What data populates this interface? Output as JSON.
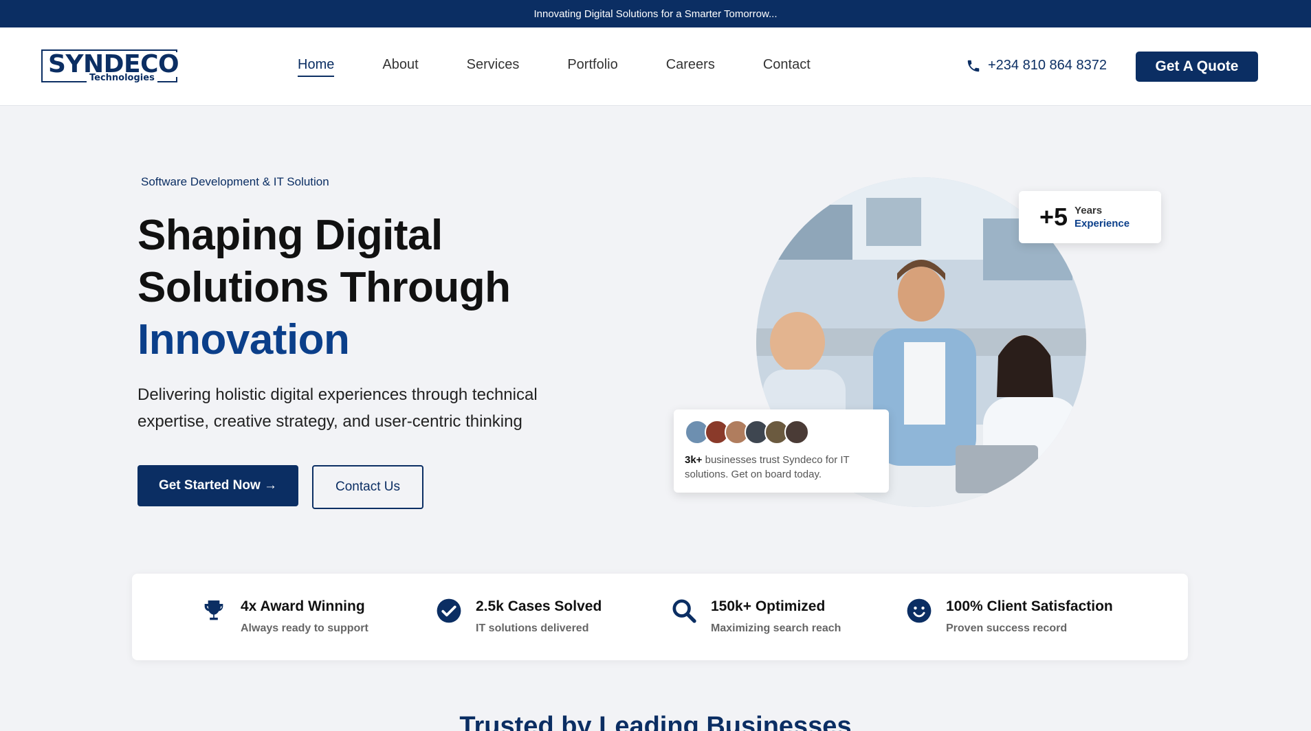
{
  "topbar": {
    "text": "Innovating Digital Solutions for a Smarter Tomorrow..."
  },
  "logo": {
    "main": "SYNDECO",
    "sub": "Technologies"
  },
  "nav": {
    "items": [
      {
        "label": "Home",
        "active": true
      },
      {
        "label": "About"
      },
      {
        "label": "Services"
      },
      {
        "label": "Portfolio"
      },
      {
        "label": "Careers"
      },
      {
        "label": "Contact"
      }
    ]
  },
  "header": {
    "phone": "+234 810 864 8372",
    "quote_label": "Get A Quote"
  },
  "hero": {
    "eyebrow": "Software Development & IT Solution",
    "title_line1": "Shaping Digital",
    "title_line2": "Solutions Through",
    "title_accent": "Innovation",
    "description": "Delivering holistic digital experiences through technical expertise, creative strategy, and user-centric thinking",
    "primary_label": "Get Started Now →",
    "secondary_label": "Contact Us"
  },
  "experience": {
    "number": "+5",
    "line1": "Years",
    "line2": "Experience"
  },
  "trust": {
    "count": "3k+",
    "text": " businesses trust Syndeco for IT solutions. Get on board today."
  },
  "stats": [
    {
      "icon": "trophy-icon",
      "title": "4x Award Winning",
      "sub": "Always ready to support"
    },
    {
      "icon": "check-circle-icon",
      "title": "2.5k Cases Solved",
      "sub": "IT solutions delivered"
    },
    {
      "icon": "magnifier-icon",
      "title": "150k+ Optimized",
      "sub": "Maximizing search reach"
    },
    {
      "icon": "smiley-icon",
      "title": "100% Client Satisfaction",
      "sub": "Proven success record"
    }
  ],
  "section": {
    "title": "Trusted by Leading Businesses"
  },
  "colors": {
    "brand": "#0b2e63",
    "accent": "#0b3f8a",
    "background": "#f2f3f6"
  }
}
